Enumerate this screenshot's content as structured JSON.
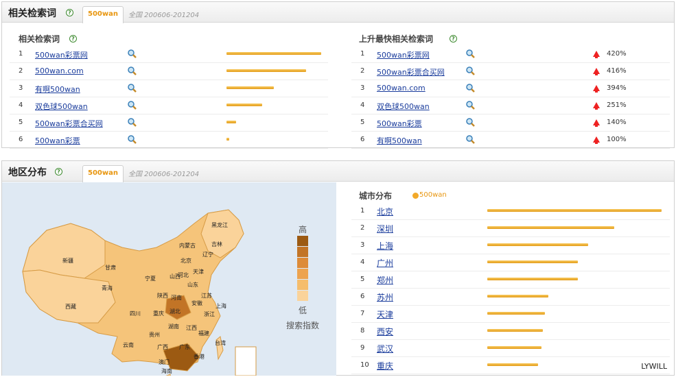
{
  "related": {
    "title": "相关检索词",
    "tab": "500wan",
    "scope": "全国 200606-201204",
    "left_title": "相关检索词",
    "right_title": "上升最快相关检索词",
    "left_rows": [
      {
        "rank": "1",
        "keyword": "500wan彩票网",
        "level": 1.0
      },
      {
        "rank": "2",
        "keyword": "500wan.com",
        "level": 0.84
      },
      {
        "rank": "3",
        "keyword": "有啊500wan",
        "level": 0.5
      },
      {
        "rank": "4",
        "keyword": "双色球500wan",
        "level": 0.38
      },
      {
        "rank": "5",
        "keyword": "500wan彩票合买网",
        "level": 0.1
      },
      {
        "rank": "6",
        "keyword": "500wan彩票",
        "level": 0.03
      }
    ],
    "right_rows": [
      {
        "rank": "1",
        "keyword": "500wan彩票网",
        "change": "420%"
      },
      {
        "rank": "2",
        "keyword": "500wan彩票合买网",
        "change": "416%"
      },
      {
        "rank": "3",
        "keyword": "500wan.com",
        "change": "394%"
      },
      {
        "rank": "4",
        "keyword": "双色球500wan",
        "change": "251%"
      },
      {
        "rank": "5",
        "keyword": "500wan彩票",
        "change": "140%"
      },
      {
        "rank": "6",
        "keyword": "有啊500wan",
        "change": "100%"
      }
    ]
  },
  "region": {
    "title": "地区分布",
    "tab": "500wan",
    "scope": "全国 200606-201204",
    "legend_high": "高",
    "legend_low": "低",
    "legend_caption": "搜索指数",
    "legend_colors": [
      "#9c5a12",
      "#c27426",
      "#dd8b38",
      "#eda34e",
      "#f5bd6c",
      "#fad39a"
    ],
    "map_labels": [
      "黑龙江",
      "吉林",
      "辽宁",
      "内蒙古",
      "北京",
      "天津",
      "河北",
      "山西",
      "山东",
      "新疆",
      "甘肃",
      "宁夏",
      "陕西",
      "河南",
      "江苏",
      "安徽",
      "上海",
      "青海",
      "西藏",
      "四川",
      "重庆",
      "湖北",
      "浙江",
      "江西",
      "湖南",
      "贵州",
      "福建",
      "云南",
      "广西",
      "广东",
      "台湾",
      "香港",
      "澳门",
      "海南"
    ],
    "city_title": "城市分布",
    "city_legend": "500wan",
    "cities": [
      {
        "rank": "1",
        "name": "北京",
        "level": 1.0
      },
      {
        "rank": "2",
        "name": "深圳",
        "level": 0.73
      },
      {
        "rank": "3",
        "name": "上海",
        "level": 0.58
      },
      {
        "rank": "4",
        "name": "广州",
        "level": 0.52
      },
      {
        "rank": "5",
        "name": "郑州",
        "level": 0.52
      },
      {
        "rank": "6",
        "name": "苏州",
        "level": 0.35
      },
      {
        "rank": "7",
        "name": "天津",
        "level": 0.33
      },
      {
        "rank": "8",
        "name": "西安",
        "level": 0.32
      },
      {
        "rank": "9",
        "name": "武汉",
        "level": 0.31
      },
      {
        "rank": "10",
        "name": "重庆",
        "level": 0.29
      }
    ]
  },
  "watermark": "LYWILL",
  "colors": {
    "bar": "#e9a52b",
    "link": "#1a3c9c",
    "tab_text": "#e8960f",
    "up": "#e22222"
  }
}
